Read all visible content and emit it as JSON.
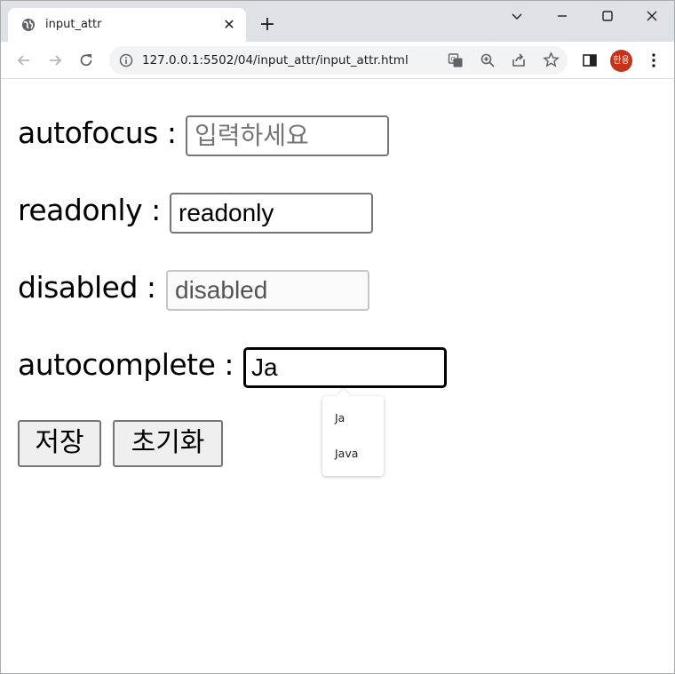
{
  "browser": {
    "tab_title": "input_attr",
    "url": "127.0.0.1:5502/04/input_attr/input_attr.html",
    "profile_initials": "한용",
    "profile_color": "#c5331a"
  },
  "form": {
    "autofocus": {
      "label": "autofocus :",
      "placeholder": "입력하세요",
      "value": ""
    },
    "readonly": {
      "label": "readonly :",
      "value": "readonly"
    },
    "disabled": {
      "label": "disabled :",
      "value": "disabled"
    },
    "autocomplete": {
      "label": "autocomplete :",
      "value": "Ja",
      "suggestions": [
        "Ja",
        "Java"
      ]
    },
    "buttons": {
      "save": "저장",
      "reset": "초기화"
    }
  }
}
